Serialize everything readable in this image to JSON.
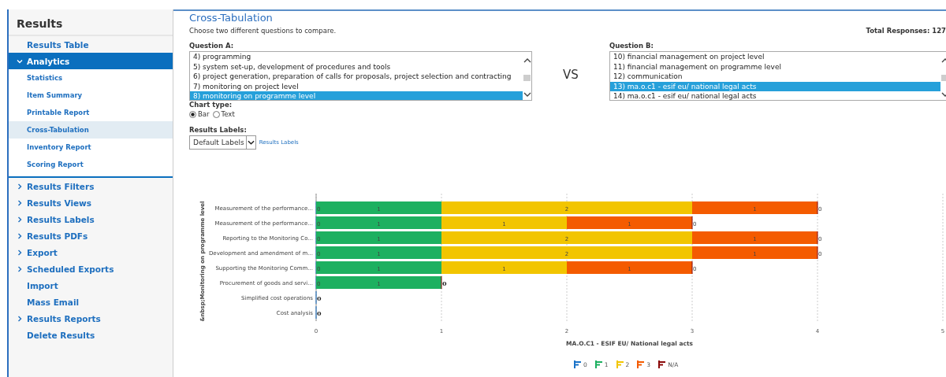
{
  "sidebar": {
    "title": "Results",
    "items": [
      {
        "label": "Results Table",
        "kind": "link",
        "selected": false
      },
      {
        "label": "Analytics",
        "kind": "group",
        "expanded": true,
        "selected": true,
        "children": [
          {
            "label": "Statistics",
            "selected": false
          },
          {
            "label": "Item Summary",
            "selected": false
          },
          {
            "label": "Printable Report",
            "selected": false
          },
          {
            "label": "Cross-Tabulation",
            "selected": true
          },
          {
            "label": "Inventory Report",
            "selected": false
          },
          {
            "label": "Scoring Report",
            "selected": false
          }
        ]
      },
      {
        "label": "Results Filters",
        "kind": "group",
        "expanded": false,
        "selected": false
      },
      {
        "label": "Results Views",
        "kind": "group",
        "expanded": false,
        "selected": false
      },
      {
        "label": "Results Labels",
        "kind": "group",
        "expanded": false,
        "selected": false
      },
      {
        "label": "Results PDFs",
        "kind": "group",
        "expanded": false,
        "selected": false
      },
      {
        "label": "Export",
        "kind": "group",
        "expanded": false,
        "selected": false
      },
      {
        "label": "Scheduled Exports",
        "kind": "group",
        "expanded": false,
        "selected": false
      },
      {
        "label": "Import",
        "kind": "link",
        "selected": false
      },
      {
        "label": "Mass Email",
        "kind": "link",
        "selected": false
      },
      {
        "label": "Results Reports",
        "kind": "group",
        "expanded": false,
        "selected": false
      },
      {
        "label": "Delete Results",
        "kind": "link",
        "selected": false
      }
    ]
  },
  "page": {
    "title": "Cross-Tabulation",
    "instructions": "Choose two different questions to compare.",
    "total_responses": "Total Responses: 127"
  },
  "question_a": {
    "label": "Question A:",
    "options": [
      {
        "text": "4) programming",
        "selected": false
      },
      {
        "text": "5) system set-up, development of procedures and tools",
        "selected": false
      },
      {
        "text": "6) project generation, preparation of calls for proposals, project selection and contracting",
        "selected": false
      },
      {
        "text": "7) monitoring on project level",
        "selected": false
      },
      {
        "text": "8) monitoring on programme level",
        "selected": true
      }
    ]
  },
  "vs": "VS",
  "question_b": {
    "label": "Question B:",
    "options": [
      {
        "text": "10) financial management on project level",
        "selected": false
      },
      {
        "text": "11) financial management on programme level",
        "selected": false
      },
      {
        "text": "12) communication",
        "selected": false
      },
      {
        "text": "13) ma.o.c1 - esif eu/ national legal acts",
        "selected": true
      },
      {
        "text": "14) ma.o.c1 - esif eu/ national legal acts",
        "selected": false
      }
    ]
  },
  "chart_type": {
    "label": "Chart type:",
    "options": [
      {
        "label": "Bar",
        "selected": true
      },
      {
        "label": "Text",
        "selected": false
      }
    ]
  },
  "results_labels": {
    "label": "Results Labels:",
    "value": "Default Labels",
    "link": "Results Labels"
  },
  "chart_data": {
    "type": "bar",
    "orientation": "horizontal",
    "stacked": true,
    "grid": true,
    "xlabel": "MA.O.C1 - ESIF EU/ National legal acts",
    "ylabel": "&nbsp;Monitoring on programme level",
    "categories": [
      "Measurement of the performance...",
      "Measurement of the performance...",
      "Reporting to the Monitoring Co...",
      "Development and amendment of m...",
      "Supporting the Monitoring Comm...",
      "Procurement of goods and servi...",
      "Simplified cost operations",
      "Cost analysis"
    ],
    "xlim": [
      0,
      5
    ],
    "xticks": [
      0,
      1,
      2,
      3,
      4,
      5
    ],
    "series": [
      {
        "name": "0",
        "color": "#1a73c8",
        "values": [
          0,
          0,
          0,
          0,
          0,
          0,
          0,
          0
        ],
        "value_labels": [
          "0",
          "0",
          "0",
          "0",
          "0",
          "0",
          "0",
          "0"
        ]
      },
      {
        "name": "1",
        "color": "#1db060",
        "values": [
          1,
          1,
          1,
          1,
          1,
          1,
          0,
          0
        ],
        "value_labels": [
          "1",
          "1",
          "1",
          "1",
          "1",
          "1",
          null,
          null
        ]
      },
      {
        "name": "2",
        "color": "#f2c500",
        "values": [
          2,
          1,
          2,
          2,
          1,
          0,
          0,
          0
        ],
        "value_labels": [
          "2",
          "1",
          "2",
          "2",
          "1",
          null,
          null,
          null
        ]
      },
      {
        "name": "3",
        "color": "#f45b00",
        "values": [
          1,
          1,
          1,
          1,
          1,
          0,
          0,
          0
        ],
        "value_labels": [
          "1",
          "1",
          "1",
          "1",
          "1",
          null,
          null,
          null
        ]
      },
      {
        "name": "N/A",
        "color": "#8b0a0a",
        "values": [
          0,
          0,
          0,
          0,
          0,
          0,
          0,
          0
        ],
        "value_labels": [
          "0",
          "0",
          "0",
          "0",
          "0",
          "0",
          null,
          null
        ]
      }
    ]
  }
}
